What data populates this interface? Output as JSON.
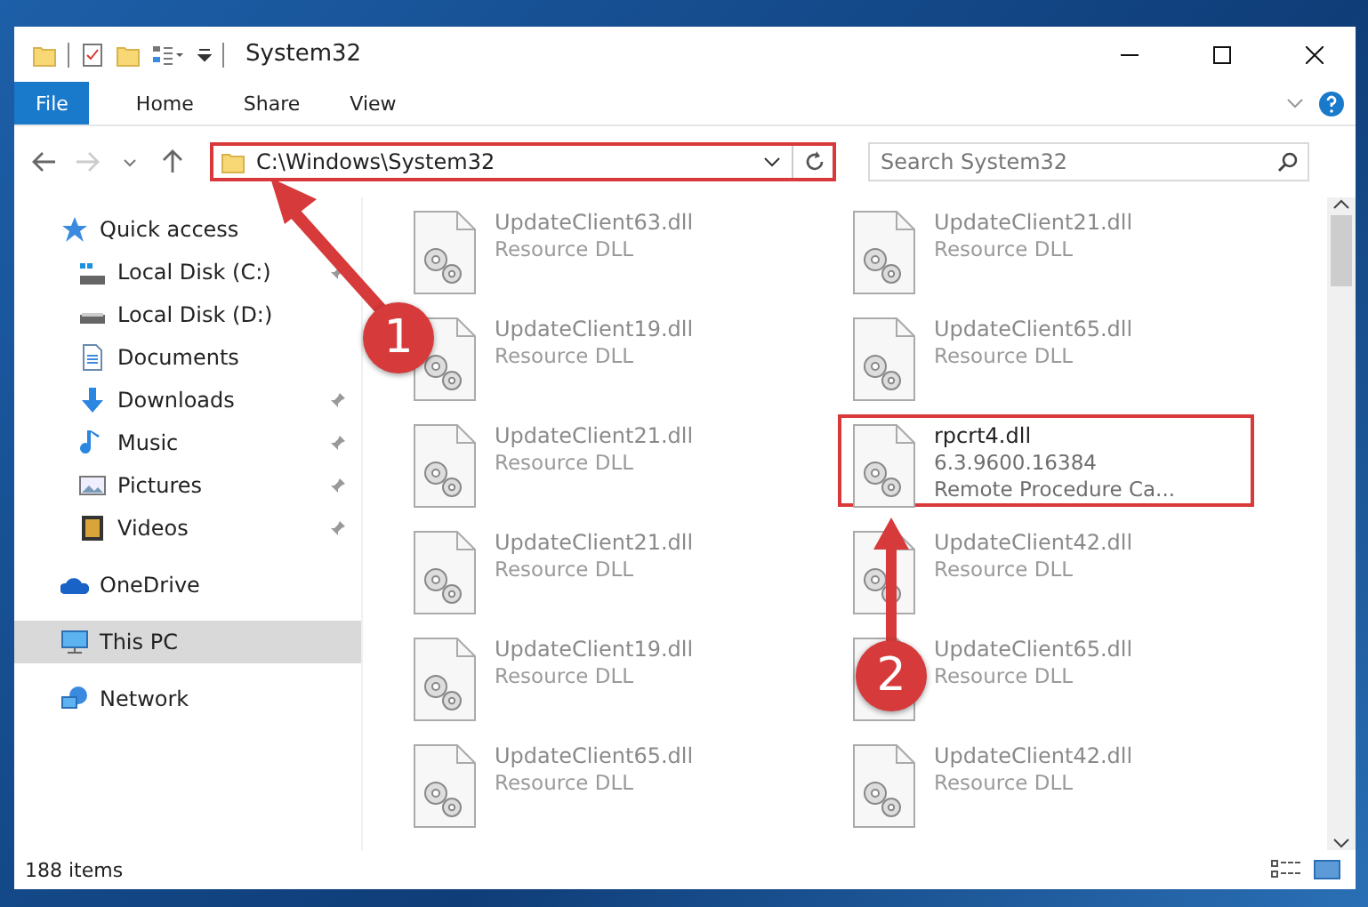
{
  "window": {
    "title": "System32"
  },
  "ribbon_tabs": [
    {
      "label": "File",
      "kind": "file"
    },
    {
      "label": "Home",
      "kind": "tab"
    },
    {
      "label": "Share",
      "kind": "tab"
    },
    {
      "label": "View",
      "kind": "tab"
    }
  ],
  "address_bar": {
    "path": "C:\\Windows\\System32",
    "highlighted": true
  },
  "search": {
    "placeholder": "Search System32"
  },
  "sidebar": {
    "items": [
      {
        "label": "Quick access",
        "selected": false,
        "children": [
          {
            "label": "Local Disk (C:)",
            "pinned": true
          },
          {
            "label": "Local Disk (D:)"
          },
          {
            "label": "Documents"
          },
          {
            "label": "Downloads",
            "pinned": true
          },
          {
            "label": "Music",
            "pinned": true
          },
          {
            "label": "Pictures",
            "pinned": true
          },
          {
            "label": "Videos",
            "pinned": true
          }
        ]
      },
      {
        "label": "OneDrive",
        "selected": false
      },
      {
        "label": "This PC",
        "selected": true
      },
      {
        "label": "Network",
        "selected": false
      }
    ]
  },
  "files": [
    {
      "lines": [
        "UpdateClient63.dll",
        "Resource DLL"
      ],
      "blurred": true,
      "highlighted": false
    },
    {
      "lines": [
        "UpdateClient21.dll",
        "Resource DLL"
      ],
      "blurred": true,
      "highlighted": false
    },
    {
      "lines": [
        "UpdateClient19.dll",
        "Resource DLL"
      ],
      "blurred": true,
      "highlighted": false
    },
    {
      "lines": [
        "UpdateClient65.dll",
        "Resource DLL"
      ],
      "blurred": true,
      "highlighted": false
    },
    {
      "lines": [
        "UpdateClient21.dll",
        "Resource DLL"
      ],
      "blurred": true,
      "highlighted": false
    },
    {
      "lines": [
        "rpcrt4.dll",
        "6.3.9600.16384",
        "Remote Procedure Ca..."
      ],
      "blurred": false,
      "highlighted": true
    },
    {
      "lines": [
        "UpdateClient21.dll",
        "Resource DLL"
      ],
      "blurred": true,
      "highlighted": false
    },
    {
      "lines": [
        "UpdateClient42.dll",
        "Resource DLL"
      ],
      "blurred": true,
      "highlighted": false
    },
    {
      "lines": [
        "UpdateClient19.dll",
        "Resource DLL"
      ],
      "blurred": true,
      "highlighted": false
    },
    {
      "lines": [
        "UpdateClient65.dll",
        "Resource DLL"
      ],
      "blurred": true,
      "highlighted": false
    },
    {
      "lines": [
        "UpdateClient65.dll",
        "Resource DLL"
      ],
      "blurred": true,
      "highlighted": false
    },
    {
      "lines": [
        "UpdateClient42.dll",
        "Resource DLL"
      ],
      "blurred": true,
      "highlighted": false
    }
  ],
  "status_bar": {
    "item_count": "188 items"
  },
  "step_markers": [
    "1",
    "2"
  ]
}
